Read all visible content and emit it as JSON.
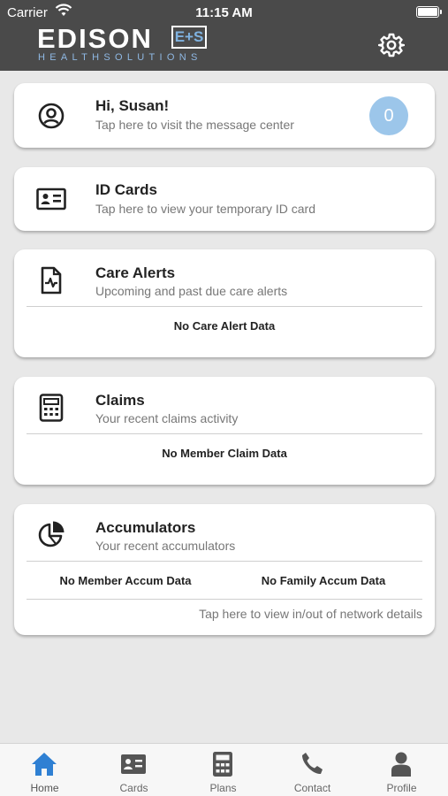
{
  "status_bar": {
    "carrier": "Carrier",
    "time": "11:15 AM"
  },
  "header": {
    "logo_word": "EDISON",
    "logo_mark": "E+S",
    "logo_subtitle": "HEALTHSOLUTIONS",
    "settings_icon": "gear-icon"
  },
  "cards": {
    "messages": {
      "title": "Hi, Susan!",
      "subtitle": "Tap here to visit the message center",
      "badge_count": "0",
      "icon": "user-circle-icon"
    },
    "id_cards": {
      "title": "ID Cards",
      "subtitle": "Tap here to view your temporary ID card",
      "icon": "id-card-icon"
    },
    "care_alerts": {
      "title": "Care Alerts",
      "subtitle": "Upcoming and past due care alerts",
      "empty_text": "No Care Alert Data",
      "icon": "medical-file-icon"
    },
    "claims": {
      "title": "Claims",
      "subtitle": "Your recent claims activity",
      "empty_text": "No Member Claim Data",
      "icon": "calculator-icon"
    },
    "accumulators": {
      "title": "Accumulators",
      "subtitle": "Your recent accumulators",
      "member_empty": "No Member Accum Data",
      "family_empty": "No Family Accum Data",
      "network_link": "Tap here to view in/out of network details",
      "icon": "pie-chart-icon"
    }
  },
  "tabbar": {
    "active_color": "#2f80d3",
    "inactive_color": "#555555",
    "items": [
      {
        "label": "Home",
        "icon": "home-icon"
      },
      {
        "label": "Cards",
        "icon": "id-card-icon"
      },
      {
        "label": "Plans",
        "icon": "calculator-icon"
      },
      {
        "label": "Contact",
        "icon": "phone-icon"
      },
      {
        "label": "Profile",
        "icon": "person-icon"
      }
    ]
  }
}
